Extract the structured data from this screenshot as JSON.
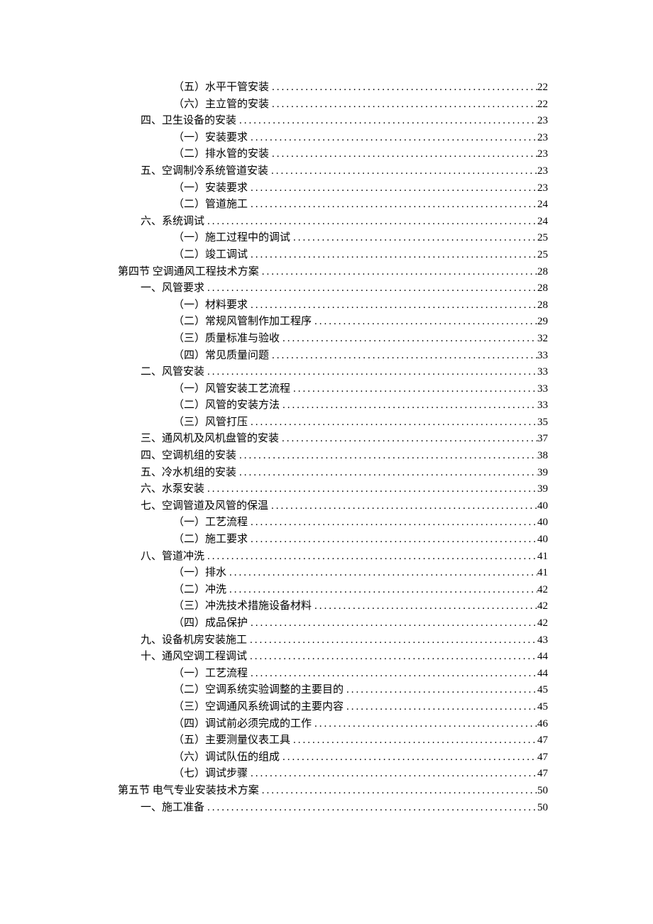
{
  "toc": [
    {
      "indent": 2,
      "label": "（五）水平干管安装",
      "page": "22"
    },
    {
      "indent": 2,
      "label": "（六）主立管的安装",
      "page": "22"
    },
    {
      "indent": 1,
      "label": "四、卫生设备的安装",
      "page": "23"
    },
    {
      "indent": 2,
      "label": "（一）安装要求",
      "page": "23"
    },
    {
      "indent": 2,
      "label": "（二）排水管的安装",
      "page": "23"
    },
    {
      "indent": 1,
      "label": "五、空调制冷系统管道安装",
      "page": "23"
    },
    {
      "indent": 2,
      "label": "（一）安装要求",
      "page": "23"
    },
    {
      "indent": 2,
      "label": "（二）管道施工",
      "page": "24"
    },
    {
      "indent": 1,
      "label": "六、系统调试",
      "page": "24"
    },
    {
      "indent": 2,
      "label": "（一）施工过程中的调试",
      "page": "25"
    },
    {
      "indent": 2,
      "label": "（二）竣工调试",
      "page": "25"
    },
    {
      "indent": 0,
      "label": "第四节  空调通风工程技术方案",
      "page": "28"
    },
    {
      "indent": 1,
      "label": "一、风管要求",
      "page": "28"
    },
    {
      "indent": 2,
      "label": "（一）材料要求",
      "page": "28"
    },
    {
      "indent": 2,
      "label": "（二）常规风管制作加工程序",
      "page": "29"
    },
    {
      "indent": 2,
      "label": "（三）质量标准与验收",
      "page": "32"
    },
    {
      "indent": 2,
      "label": "（四）常见质量问题",
      "page": "33"
    },
    {
      "indent": 1,
      "label": "二、风管安装",
      "page": "33"
    },
    {
      "indent": 2,
      "label": "（一）风管安装工艺流程",
      "page": "33"
    },
    {
      "indent": 2,
      "label": "（二）风管的安装方法",
      "page": "33"
    },
    {
      "indent": 2,
      "label": "（三）风管打压",
      "page": "35"
    },
    {
      "indent": 1,
      "label": "三、通风机及风机盘管的安装",
      "page": "37"
    },
    {
      "indent": 1,
      "label": "四、空调机组的安装",
      "page": "38"
    },
    {
      "indent": 1,
      "label": "五、冷水机组的安装",
      "page": "39"
    },
    {
      "indent": 1,
      "label": "六、水泵安装",
      "page": "39"
    },
    {
      "indent": 1,
      "label": "七、空调管道及风管的保温",
      "page": "40"
    },
    {
      "indent": 2,
      "label": "（一）工艺流程",
      "page": "40"
    },
    {
      "indent": 2,
      "label": "（二）施工要求",
      "page": "40"
    },
    {
      "indent": 1,
      "label": "八、管道冲洗",
      "page": "41"
    },
    {
      "indent": 2,
      "label": "（一）排水",
      "page": "41"
    },
    {
      "indent": 2,
      "label": "（二）冲洗",
      "page": "42"
    },
    {
      "indent": 2,
      "label": "（三）冲洗技术措施设备材料",
      "page": "42"
    },
    {
      "indent": 2,
      "label": "（四）成品保护",
      "page": "42"
    },
    {
      "indent": 1,
      "label": "九、设备机房安装施工",
      "page": "43"
    },
    {
      "indent": 1,
      "label": "十、通风空调工程调试",
      "page": "44"
    },
    {
      "indent": 2,
      "label": "（一）工艺流程",
      "page": "44"
    },
    {
      "indent": 2,
      "label": "（二）空调系统实验调整的主要目的",
      "page": "45"
    },
    {
      "indent": 2,
      "label": "（三）空调通风系统调试的主要内容",
      "page": "45"
    },
    {
      "indent": 2,
      "label": "（四）调试前必须完成的工作",
      "page": "46"
    },
    {
      "indent": 2,
      "label": "（五）主要测量仪表工具",
      "page": "47"
    },
    {
      "indent": 2,
      "label": "（六）调试队伍的组成",
      "page": "47"
    },
    {
      "indent": 2,
      "label": "（七）调试步骤",
      "page": "47"
    },
    {
      "indent": 0,
      "label": "第五节  电气专业安装技术方案",
      "page": "50"
    },
    {
      "indent": 1,
      "label": "一、施工准备",
      "page": "50"
    }
  ]
}
